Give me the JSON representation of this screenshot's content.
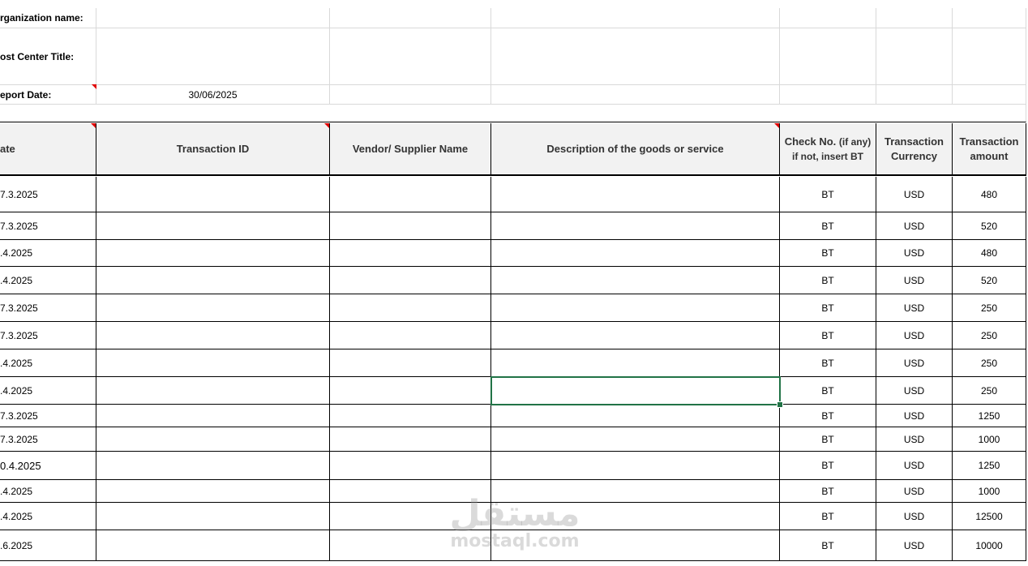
{
  "info": {
    "org_label": "rganization name:",
    "org_value": "",
    "cost_label": "ost Center Title:",
    "cost_value": "",
    "date_label": "eport Date:",
    "date_value": "30/06/2025"
  },
  "headers": {
    "date": "ate",
    "transaction_id": "Transaction ID",
    "vendor": "Vendor/ Supplier Name",
    "description": "Description of the goods or service",
    "check_no_line1": "Check No.",
    "check_no_hint": "(if any)",
    "check_no_line2": "if not, insert BT",
    "currency": "Transaction Currency",
    "amount": "Transaction amount"
  },
  "rows": [
    {
      "date": "7.3.2025",
      "txn": "",
      "vendor": "",
      "desc": "",
      "check": "BT",
      "currency": "USD",
      "amount": "480"
    },
    {
      "date": "7.3.2025",
      "txn": "",
      "vendor": "",
      "desc": "",
      "check": "BT",
      "currency": "USD",
      "amount": "520"
    },
    {
      "date": ".4.2025",
      "txn": "",
      "vendor": "",
      "desc": "",
      "check": "BT",
      "currency": "USD",
      "amount": "480"
    },
    {
      "date": ".4.2025",
      "txn": "",
      "vendor": "",
      "desc": "",
      "check": "BT",
      "currency": "USD",
      "amount": "520"
    },
    {
      "date": "7.3.2025",
      "txn": "",
      "vendor": "",
      "desc": "",
      "check": "BT",
      "currency": "USD",
      "amount": "250"
    },
    {
      "date": "7.3.2025",
      "txn": "",
      "vendor": "",
      "desc": "",
      "check": "BT",
      "currency": "USD",
      "amount": "250"
    },
    {
      "date": ".4.2025",
      "txn": "",
      "vendor": "",
      "desc": "",
      "check": "BT",
      "currency": "USD",
      "amount": "250"
    },
    {
      "date": ".4.2025",
      "txn": "",
      "vendor": "",
      "desc": "",
      "check": "BT",
      "currency": "USD",
      "amount": "250"
    },
    {
      "date": "7.3.2025",
      "txn": "",
      "vendor": "",
      "desc": "",
      "check": "BT",
      "currency": "USD",
      "amount": "1250"
    },
    {
      "date": "7.3.2025",
      "txn": "",
      "vendor": "",
      "desc": "",
      "check": "BT",
      "currency": "USD",
      "amount": "1000"
    },
    {
      "date": "0.4.2025",
      "txn": "",
      "vendor": "",
      "desc": "",
      "check": "BT",
      "currency": "USD",
      "amount": "1250"
    },
    {
      "date": ".4.2025",
      "txn": "",
      "vendor": "",
      "desc": "",
      "check": "BT",
      "currency": "USD",
      "amount": "1000"
    },
    {
      "date": ".4.2025",
      "txn": "",
      "vendor": "",
      "desc": "",
      "check": "BT",
      "currency": "USD",
      "amount": "12500"
    },
    {
      "date": ".6.2025",
      "txn": "",
      "vendor": "",
      "desc": "",
      "check": "BT",
      "currency": "USD",
      "amount": "10000"
    }
  ],
  "selected_row_index": 7,
  "selected_column": "desc",
  "watermark": {
    "arabic": "مستقل",
    "latin": "mostaql.com"
  },
  "colors": {
    "selection": "#217346",
    "comment_indicator": "#e00000",
    "header_fill": "#f2f2f2",
    "gridline": "#d9d9d9"
  }
}
